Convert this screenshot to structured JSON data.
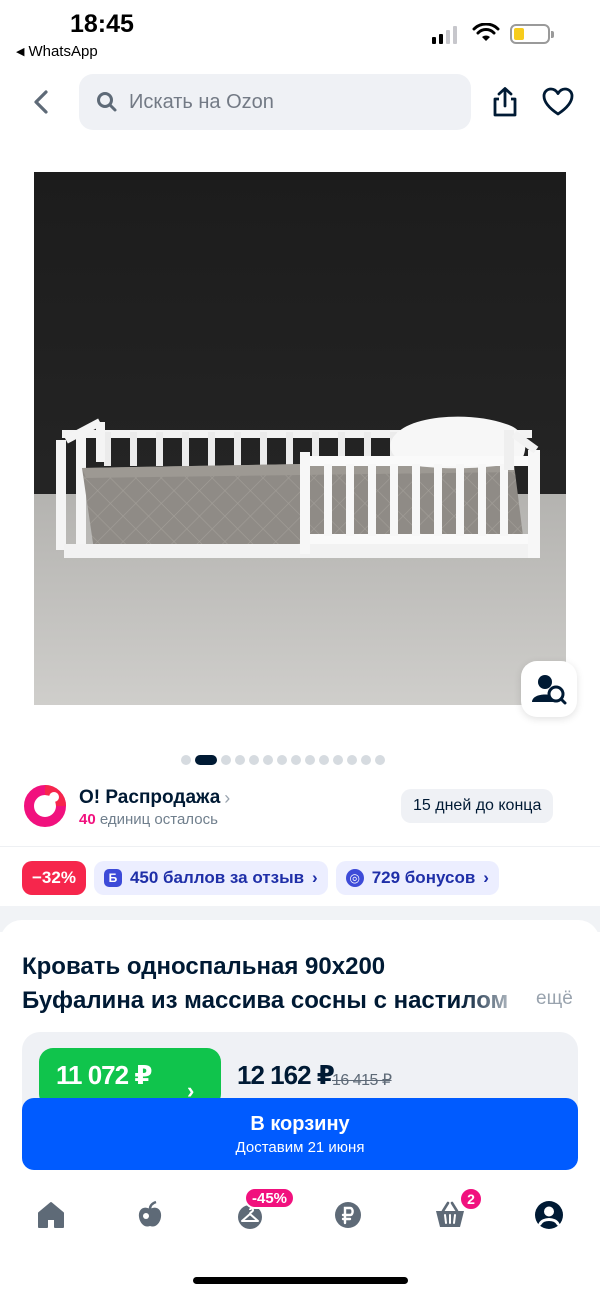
{
  "status_bar": {
    "time": "18:45",
    "back_app": "WhatsApp",
    "icons": [
      "cellular-signal-icon",
      "wifi-icon",
      "battery-icon"
    ]
  },
  "header": {
    "search_placeholder": "Искать на Ozon",
    "icons": [
      "back-chevron-icon",
      "search-icon",
      "share-icon",
      "heart-icon"
    ]
  },
  "gallery": {
    "image_description": "white wooden floor bed with rails",
    "dots_total": 14,
    "active_dot": 1
  },
  "sale": {
    "title": "О! Распродажа",
    "units_count": "40",
    "units_text": "единиц осталось",
    "days_left": "15 дней до конца"
  },
  "chips": {
    "discount": "−32%",
    "reviews_icon_letter": "Б",
    "reviews": "450 баллов за отзыв",
    "bonus": "729 бонусов"
  },
  "product": {
    "title_line1": "Кровать односпальная 90х200",
    "title_line2": "Буфалина из массива сосны с настилом",
    "more": "ещё"
  },
  "prices": {
    "ozon_card_price": "11 072 ₽",
    "price": "12 162 ₽",
    "old_price": "16 415 ₽"
  },
  "cart_button": {
    "label": "В корзину",
    "delivery": "Доставим 21 июня"
  },
  "tabbar": {
    "tabs": [
      "home",
      "fresh",
      "sale",
      "finance",
      "cart",
      "profile"
    ],
    "sale_badge": "-45%",
    "cart_badge": "2"
  },
  "colors": {
    "accent_blue": "#005bff",
    "ozon_green": "#10c44c",
    "pink": "#f1117e",
    "discount_red": "#f6264c"
  }
}
